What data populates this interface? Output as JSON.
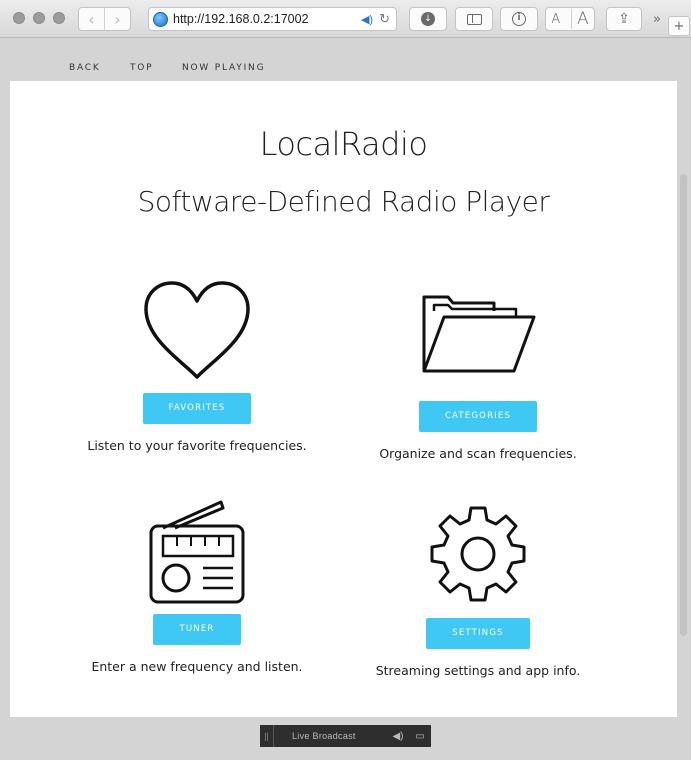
{
  "browser": {
    "url": "http://192.168.0.2:17002",
    "font_small": "A",
    "font_large": "A"
  },
  "nav": {
    "back": "BACK",
    "top": "TOP",
    "now_playing": "NOW PLAYING"
  },
  "page": {
    "title": "LocalRadio",
    "subtitle": "Software-Defined Radio Player"
  },
  "tiles": [
    {
      "icon": "heart-icon",
      "button": "FAVORITES",
      "description": "Listen to your favorite frequencies."
    },
    {
      "icon": "folder-icon",
      "button": "CATEGORIES",
      "description": "Organize and scan frequencies."
    },
    {
      "icon": "radio-icon",
      "button": "TUNER",
      "description": "Enter a new frequency and listen."
    },
    {
      "icon": "gear-icon",
      "button": "SETTINGS",
      "description": "Streaming settings and app info."
    }
  ],
  "media_bar": {
    "label": "Live Broadcast"
  },
  "colors": {
    "accent": "#3ec8f3",
    "chrome": "#d4d4d4"
  }
}
